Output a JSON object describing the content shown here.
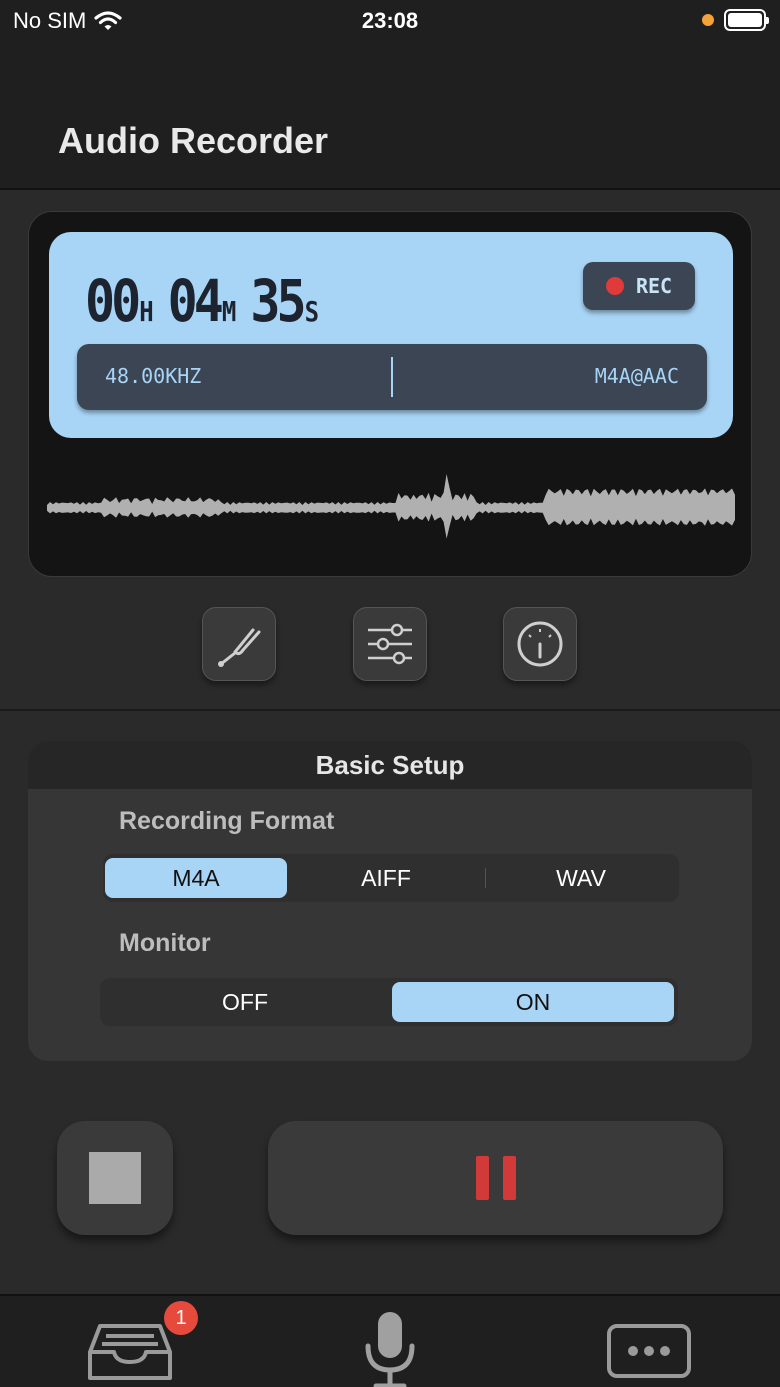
{
  "status_bar": {
    "carrier": "No SIM",
    "time": "23:08"
  },
  "header": {
    "title": "Audio Recorder"
  },
  "display": {
    "timer": {
      "hours": "00",
      "hours_unit": "H",
      "minutes": "04",
      "minutes_unit": "M",
      "seconds": "35",
      "seconds_unit": "S"
    },
    "rec_label": "REC",
    "sample_rate": "48.00KHZ",
    "format": "M4A@AAC"
  },
  "tools": [
    {
      "icon": "tuning-fork-icon"
    },
    {
      "icon": "sliders-icon"
    },
    {
      "icon": "gauge-icon"
    }
  ],
  "setup": {
    "title": "Basic Setup",
    "recording_format": {
      "label": "Recording Format",
      "options": [
        "M4A",
        "AIFF",
        "WAV"
      ],
      "selected": "M4A"
    },
    "monitor": {
      "label": "Monitor",
      "options": [
        "OFF",
        "ON"
      ],
      "selected": "ON"
    }
  },
  "tab_bar": {
    "tabs": [
      {
        "icon": "inbox-icon"
      },
      {
        "icon": "microphone-icon"
      },
      {
        "icon": "more-icon"
      }
    ],
    "inbox_badge": "1"
  },
  "colors": {
    "accent": "#a8d4f6",
    "record_red": "#d23a3a",
    "badge": "#e54a3c"
  }
}
